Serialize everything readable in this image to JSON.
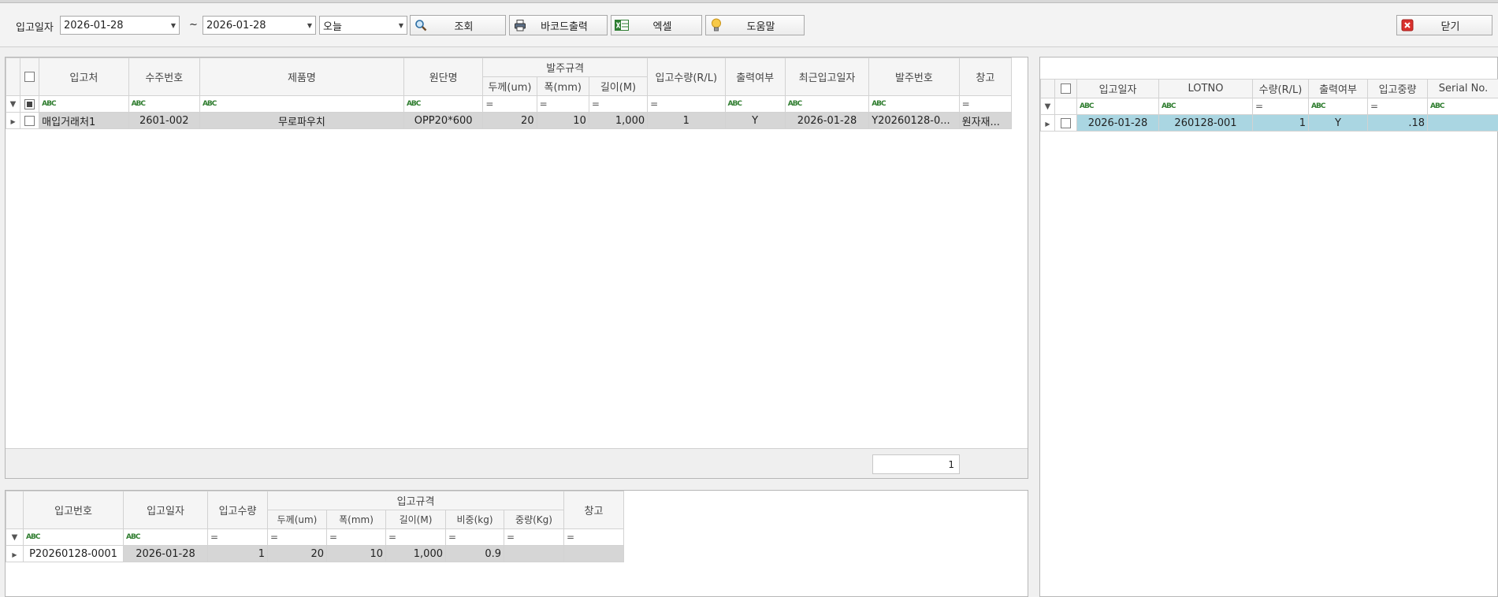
{
  "toolbar": {
    "date_label": "입고일자",
    "date_from": "2026-01-28",
    "tilde": "~",
    "date_to": "2026-01-28",
    "period": "오늘",
    "search_label": "조회",
    "barcode_label": "바코드출력",
    "excel_label": "엑셀",
    "help_label": "도움말",
    "close_label": "닫기"
  },
  "main_grid": {
    "headers": {
      "supplier": "입고처",
      "order_no": "수주번호",
      "product": "제품명",
      "raw": "원단명",
      "spec_group": "발주규격",
      "thickness": "두께(um)",
      "width": "폭(mm)",
      "length": "길이(M)",
      "in_qty": "입고수량(R/L)",
      "printed": "출력여부",
      "last_in_date": "최근입고일자",
      "po_no": "발주번호",
      "warehouse": "창고"
    },
    "rows": [
      {
        "supplier": "매입거래처1",
        "order_no": "2601-002",
        "product": "무로파우치",
        "raw": "OPP20*600",
        "thickness": "20",
        "width": "10",
        "length": "1,000",
        "in_qty": "1",
        "printed": "Y",
        "last_in_date": "2026-01-28",
        "po_no": "Y20260128-0...",
        "warehouse": "원자재..."
      }
    ],
    "footer_count": "1"
  },
  "right_grid": {
    "headers": {
      "in_date": "입고일자",
      "lotno": "LOTNO",
      "qty": "수량(R/L)",
      "printed": "출력여부",
      "weight": "입고중량",
      "serial": "Serial No."
    },
    "rows": [
      {
        "in_date": "2026-01-28",
        "lotno": "260128-001",
        "qty": "1",
        "printed": "Y",
        "weight": ".18",
        "serial": ""
      }
    ]
  },
  "bottom_grid": {
    "headers": {
      "in_no": "입고번호",
      "in_date": "입고일자",
      "in_qty": "입고수량",
      "spec_group": "입고규격",
      "thickness": "두께(um)",
      "width": "폭(mm)",
      "length": "길이(M)",
      "density": "비중(kg)",
      "weight": "중량(Kg)",
      "warehouse": "창고"
    },
    "rows": [
      {
        "in_no": "P20260128-0001",
        "in_date": "2026-01-28",
        "in_qty": "1",
        "thickness": "20",
        "width": "10",
        "length": "1,000",
        "density": "0.9",
        "weight": "",
        "warehouse": ""
      }
    ]
  },
  "filter_marks": {
    "abc": "ABC",
    "eq": "="
  },
  "icons": {
    "search": "magnifier-icon",
    "barcode": "printer-icon",
    "excel": "excel-icon",
    "help": "lightbulb-icon",
    "close": "close-icon"
  }
}
